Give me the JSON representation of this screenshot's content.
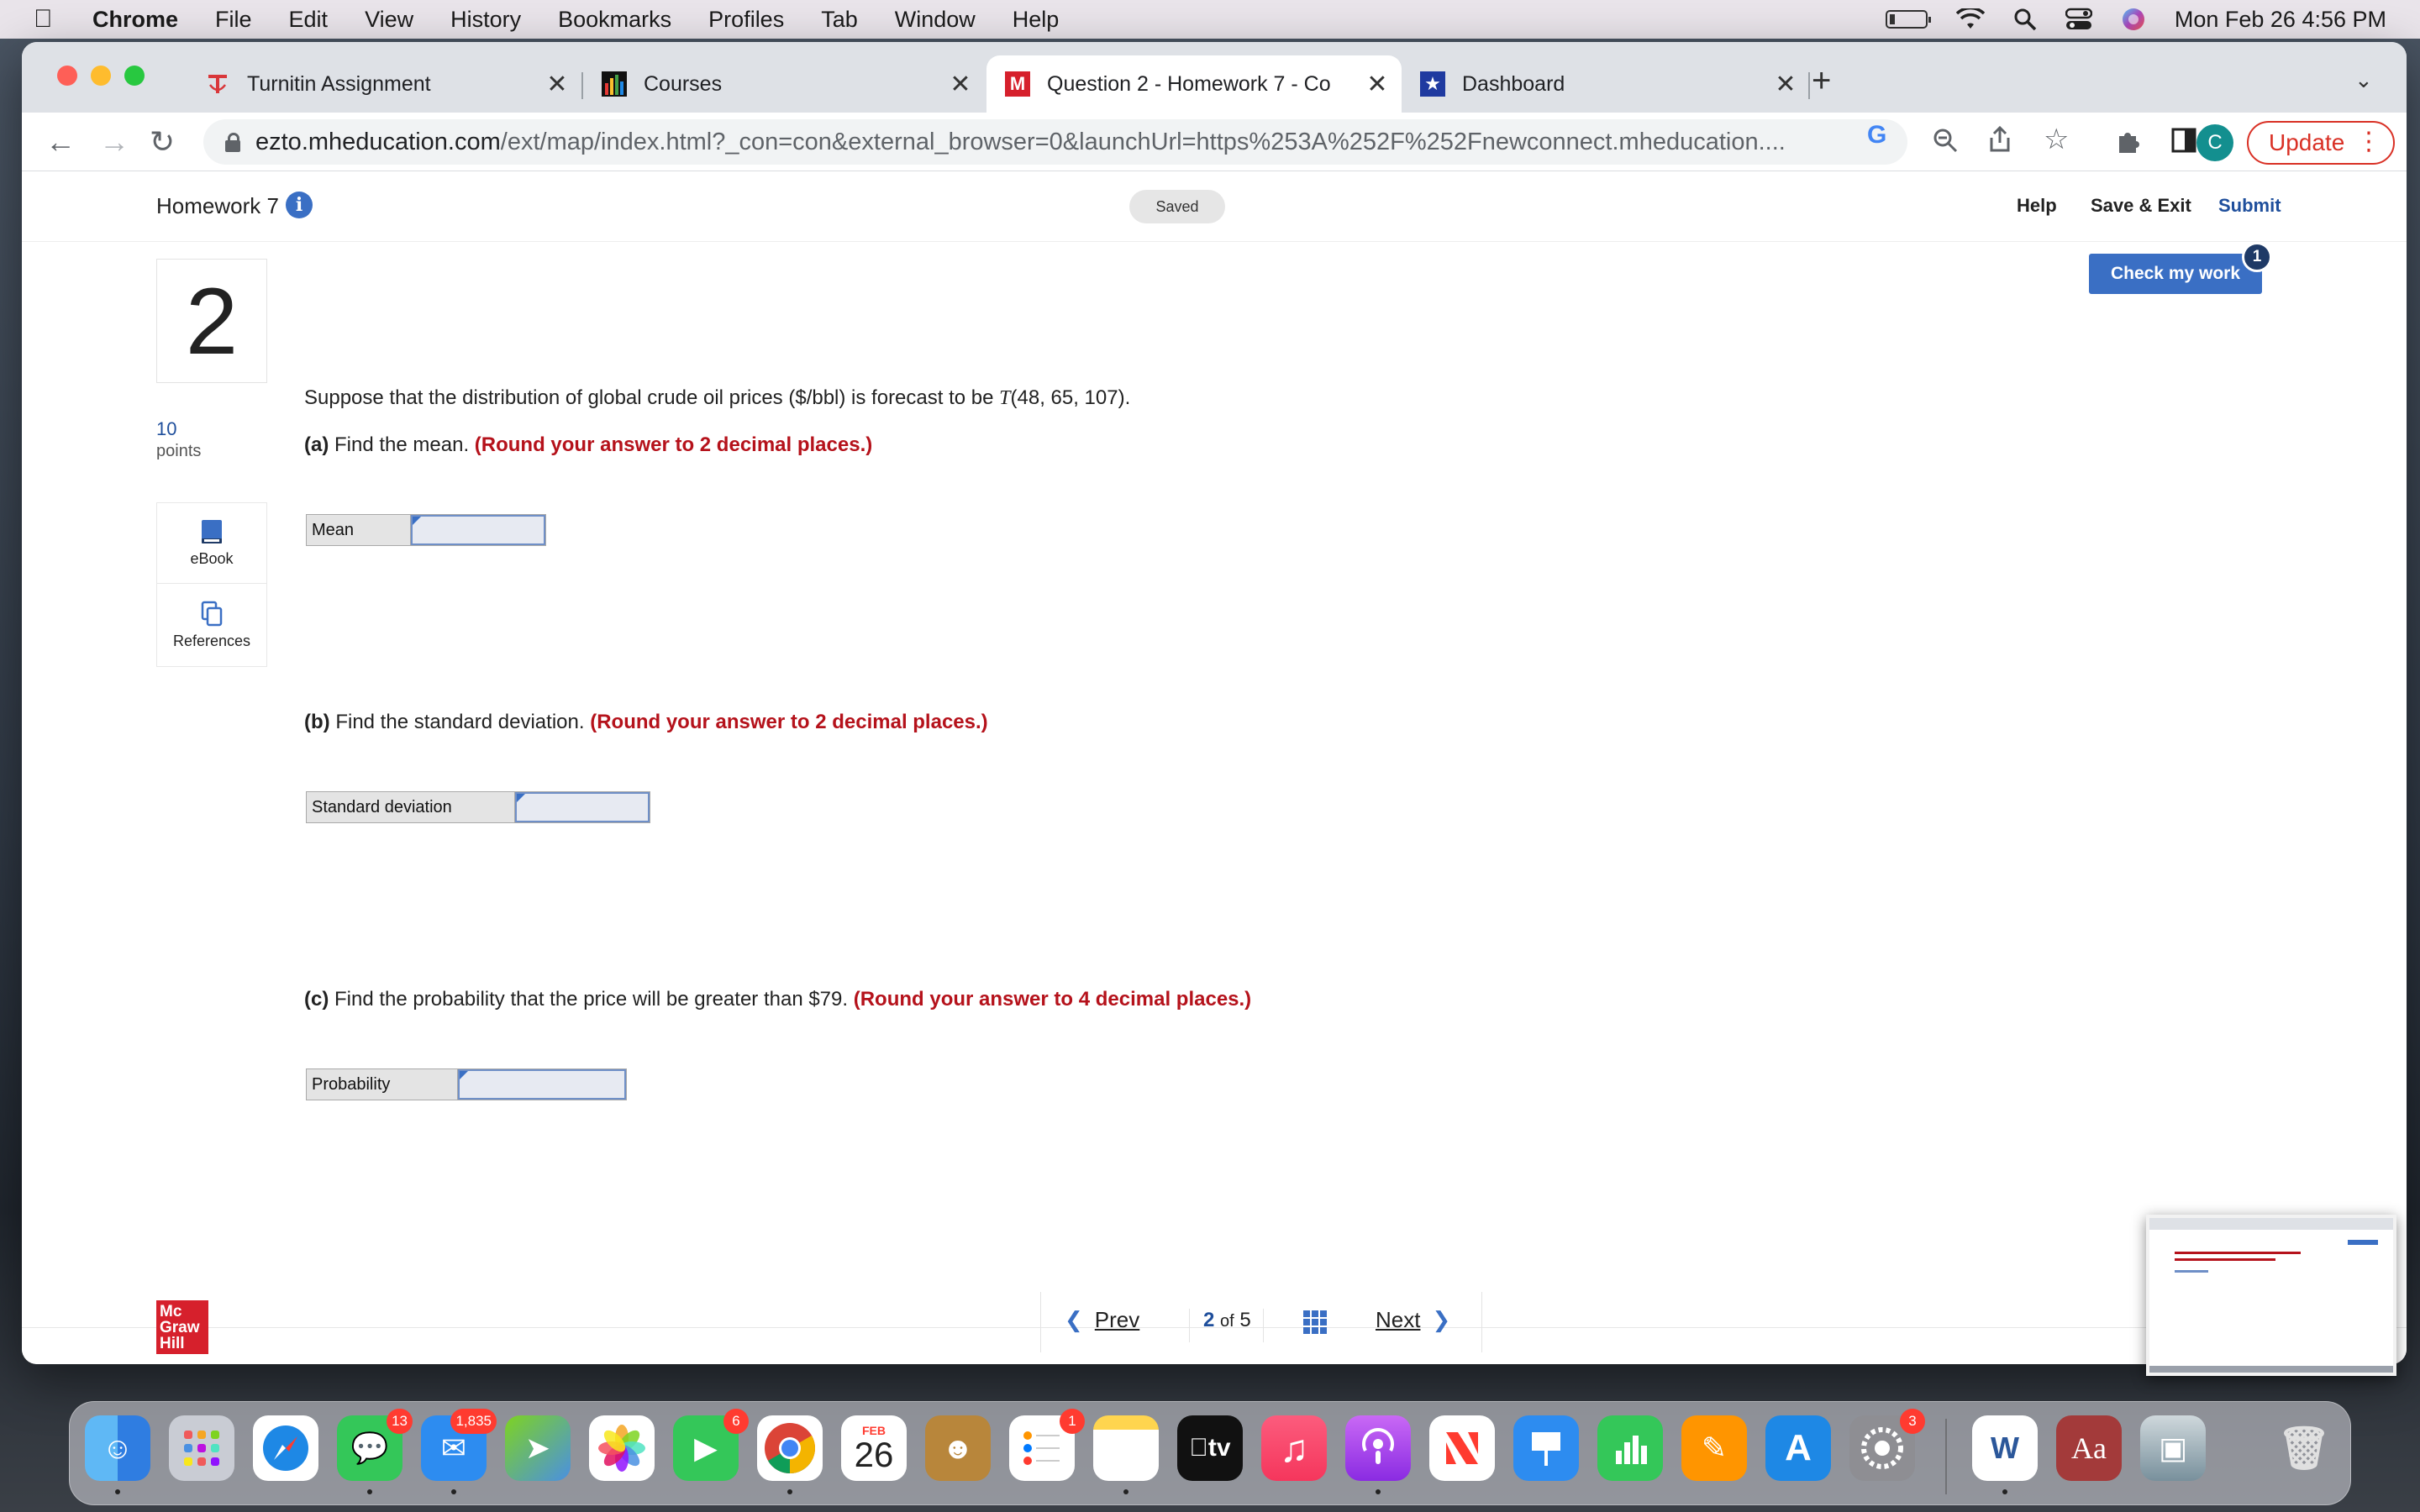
{
  "menubar": {
    "app_name": "Chrome",
    "items": [
      "File",
      "Edit",
      "View",
      "History",
      "Bookmarks",
      "Profiles",
      "Tab",
      "Window",
      "Help"
    ],
    "datetime": "Mon Feb 26  4:56 PM"
  },
  "browser": {
    "tabs": [
      {
        "title": "Turnitin Assignment",
        "favicon": "turnitin-icon"
      },
      {
        "title": "Courses",
        "favicon": "courses-chart-icon"
      },
      {
        "title": "Question 2 - Homework 7 - Co",
        "favicon": "mcgraw-m-icon",
        "active": true
      },
      {
        "title": "Dashboard",
        "favicon": "dashboard-star-icon"
      }
    ],
    "url_host": "ezto.mheducation.com",
    "url_path": "/ext/map/index.html?_con=con&external_browser=0&launchUrl=https%253A%252F%252Fnewconnect.mheducation....",
    "profile_initial": "C",
    "update_label": "Update"
  },
  "assignment": {
    "title": "Homework 7",
    "status": "Saved",
    "help": "Help",
    "save_exit": "Save & Exit",
    "submit": "Submit",
    "check_button": "Check my work",
    "check_badge": "1",
    "question_number": "2",
    "points_value": "10",
    "points_label": "points",
    "tools": {
      "ebook": "eBook",
      "references": "References"
    }
  },
  "question": {
    "stem_prefix": "Suppose that the distribution of global crude oil prices ($/bbl) is forecast to be",
    "stem_dist": "T",
    "stem_params": "(48, 65, 107).",
    "parts": [
      {
        "label": "(a)",
        "text": "Find the mean.",
        "instruction": "(Round your answer to 2 decimal places.)",
        "field_label": "Mean",
        "value": ""
      },
      {
        "label": "(b)",
        "text": "Find the standard deviation.",
        "instruction": "(Round your answer to 2 decimal places.)",
        "field_label": "Standard deviation",
        "value": ""
      },
      {
        "label": "(c)",
        "text": "Find the probability that the price will be greater than $79.",
        "instruction": "(Round your answer to 4 decimal places.)",
        "field_label": "Probability",
        "value": ""
      }
    ]
  },
  "footer": {
    "logo_lines": [
      "Mc",
      "Graw",
      "Hill"
    ],
    "prev": "Prev",
    "current_page": "2",
    "of": "of",
    "total_pages": "5",
    "next": "Next"
  },
  "dock": {
    "badges": {
      "messages": "13",
      "mail": "1,835",
      "facetime": "6",
      "reminders": "1",
      "settings": "3"
    },
    "calendar_month": "FEB",
    "calendar_day": "26",
    "tv_label": "tv"
  }
}
